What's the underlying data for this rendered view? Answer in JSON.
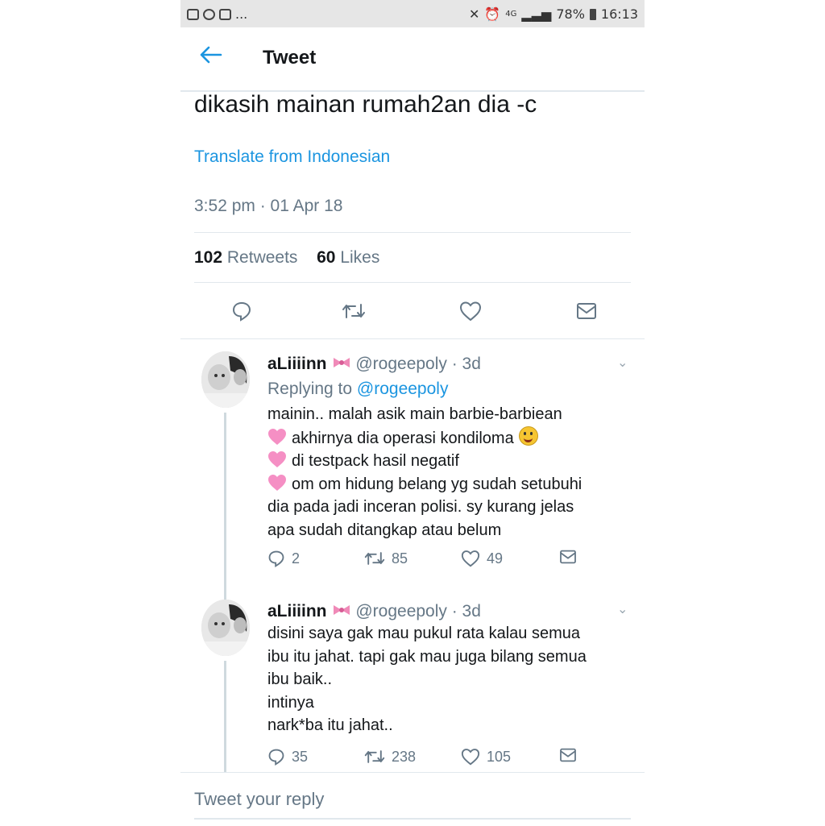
{
  "status_bar": {
    "left_icons": [
      "gallery-icon",
      "whatsapp-icon",
      "instagram-icon"
    ],
    "dots": "...",
    "network": "4G",
    "battery": "78%",
    "time": "16:13"
  },
  "header": {
    "title": "Tweet"
  },
  "tweet": {
    "text": "dikasih mainan rumah2an dia -c",
    "translate": "Translate from Indonesian",
    "timestamp": "3:52 pm · 01 Apr 18",
    "retweets_count": "102",
    "retweets_label": "Retweets",
    "likes_count": "60",
    "likes_label": "Likes"
  },
  "replies": [
    {
      "name": "aLiiiinn",
      "handle_time": "@rogeepoly · 3d",
      "replying_prefix": "Replying to",
      "replying_handle": "@rogeepoly",
      "lines": {
        "l1": "mainin.. malah asik main barbie-barbiean",
        "l2": "akhirnya dia operasi kondiloma",
        "l3": "di testpack hasil negatif",
        "l4": "om om hidung belang yg sudah setubuhi",
        "l5": "dia pada jadi inceran polisi. sy kurang jelas",
        "l6": "apa sudah ditangkap atau belum"
      },
      "reply_count": "2",
      "retweet_count": "85",
      "like_count": "49"
    },
    {
      "name": "aLiiiinn",
      "handle_time": "@rogeepoly · 3d",
      "lines": {
        "l1": "disini saya gak mau pukul rata kalau semua",
        "l2": "ibu itu jahat. tapi gak mau juga bilang semua",
        "l3": "ibu baik..",
        "l4": "intinya",
        "l5": "nark*ba itu jahat.."
      },
      "reply_count": "35",
      "retweet_count": "238",
      "like_count": "105"
    }
  ],
  "reply_box": {
    "placeholder": "Tweet your reply"
  },
  "colors": {
    "accent": "#1b95e0",
    "muted": "#657786",
    "text": "#14171a",
    "heart_emoji": "#f58fc4"
  }
}
